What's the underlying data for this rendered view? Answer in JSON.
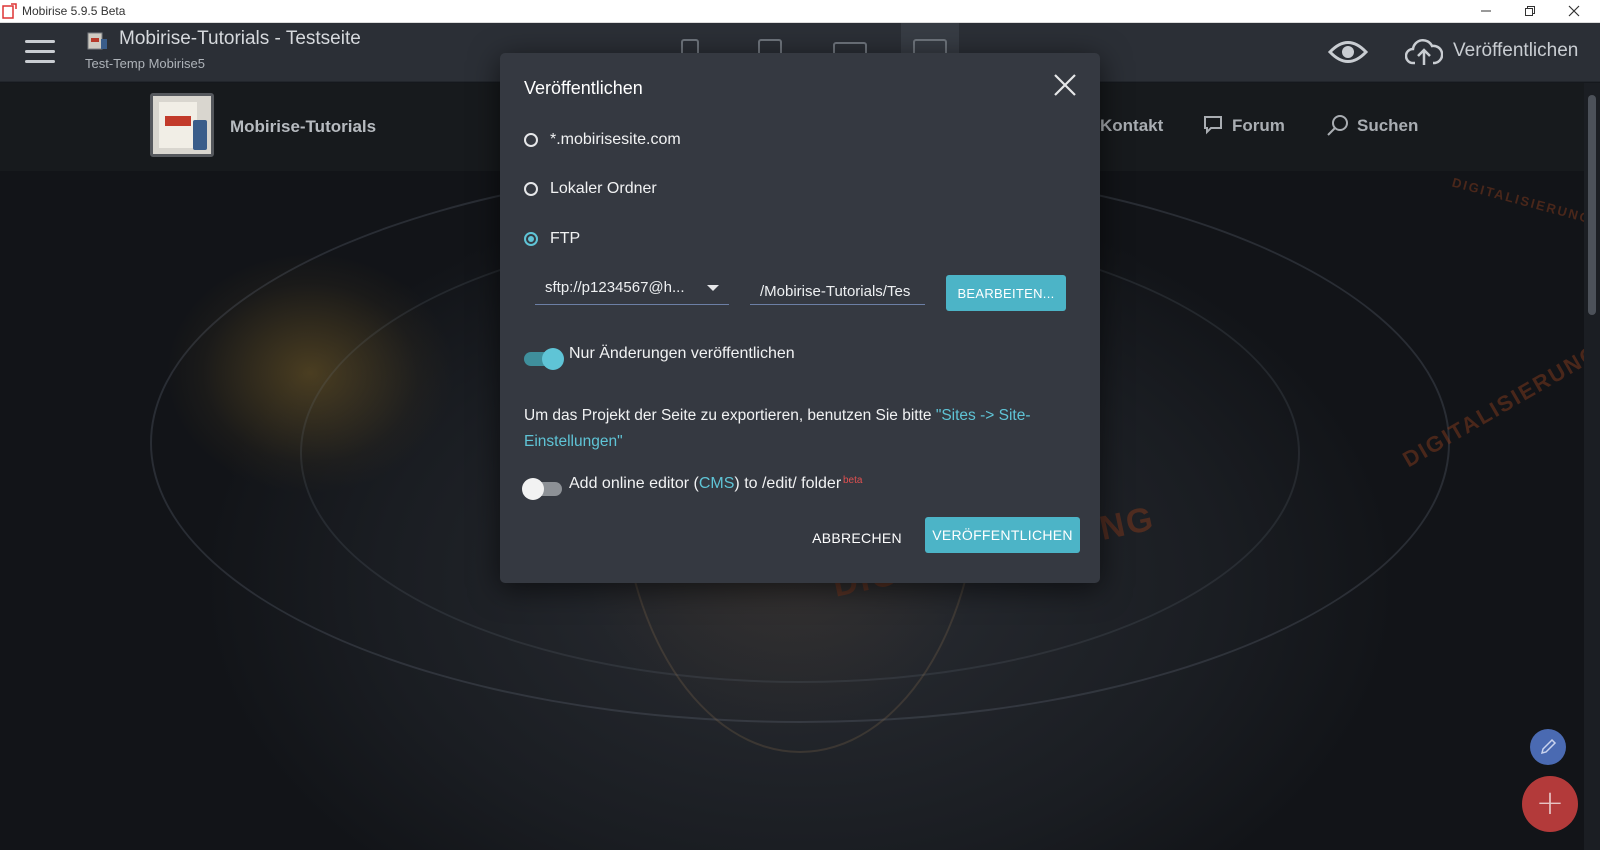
{
  "window": {
    "title": "Mobirise 5.9.5 Beta"
  },
  "topbar": {
    "project_title": "Mobirise-Tutorials - Testseite",
    "project_subtitle": "Test-Temp Mobirise5",
    "publish_label": "Veröffentlichen",
    "active_device": "desktop"
  },
  "site": {
    "brand": "Mobirise-Tutorials",
    "nav": [
      {
        "label": "Kontakt"
      },
      {
        "label": "Forum",
        "icon": "chat-icon"
      },
      {
        "label": "Suchen",
        "icon": "search-icon"
      }
    ],
    "watermark": "DIGITALISIERUNG"
  },
  "modal": {
    "title": "Veröffentlichen",
    "options": [
      {
        "label": "*.mobirisesite.com",
        "checked": false
      },
      {
        "label": "Lokaler Ordner",
        "checked": false
      },
      {
        "label": "FTP",
        "checked": true
      }
    ],
    "ftp_connection": "sftp://p1234567@h...",
    "ftp_path": "/Mobirise-Tutorials/Tes",
    "edit_button": "BEARBEITEN...",
    "only_changes_label": "Nur Änderungen veröffentlichen",
    "only_changes_on": true,
    "info_text_before": "Um das Projekt der Seite zu exportieren, benutzen Sie bitte ",
    "info_link": "\"Sites -> Site-Einstellungen\"",
    "cms_label_before": "Add online editor (",
    "cms_link": "CMS",
    "cms_label_after": ") to /edit/ folder",
    "cms_badge": "beta",
    "cms_on": false,
    "cancel_button": "ABBRECHEN",
    "publish_button": "VERÖFFENTLICHEN"
  },
  "colors": {
    "accent": "#4cb4c7",
    "modal_bg": "#353941",
    "topbar_bg": "#2b2f36",
    "fab_add": "#b33a3a",
    "fab_edit": "#4a6ab2"
  }
}
